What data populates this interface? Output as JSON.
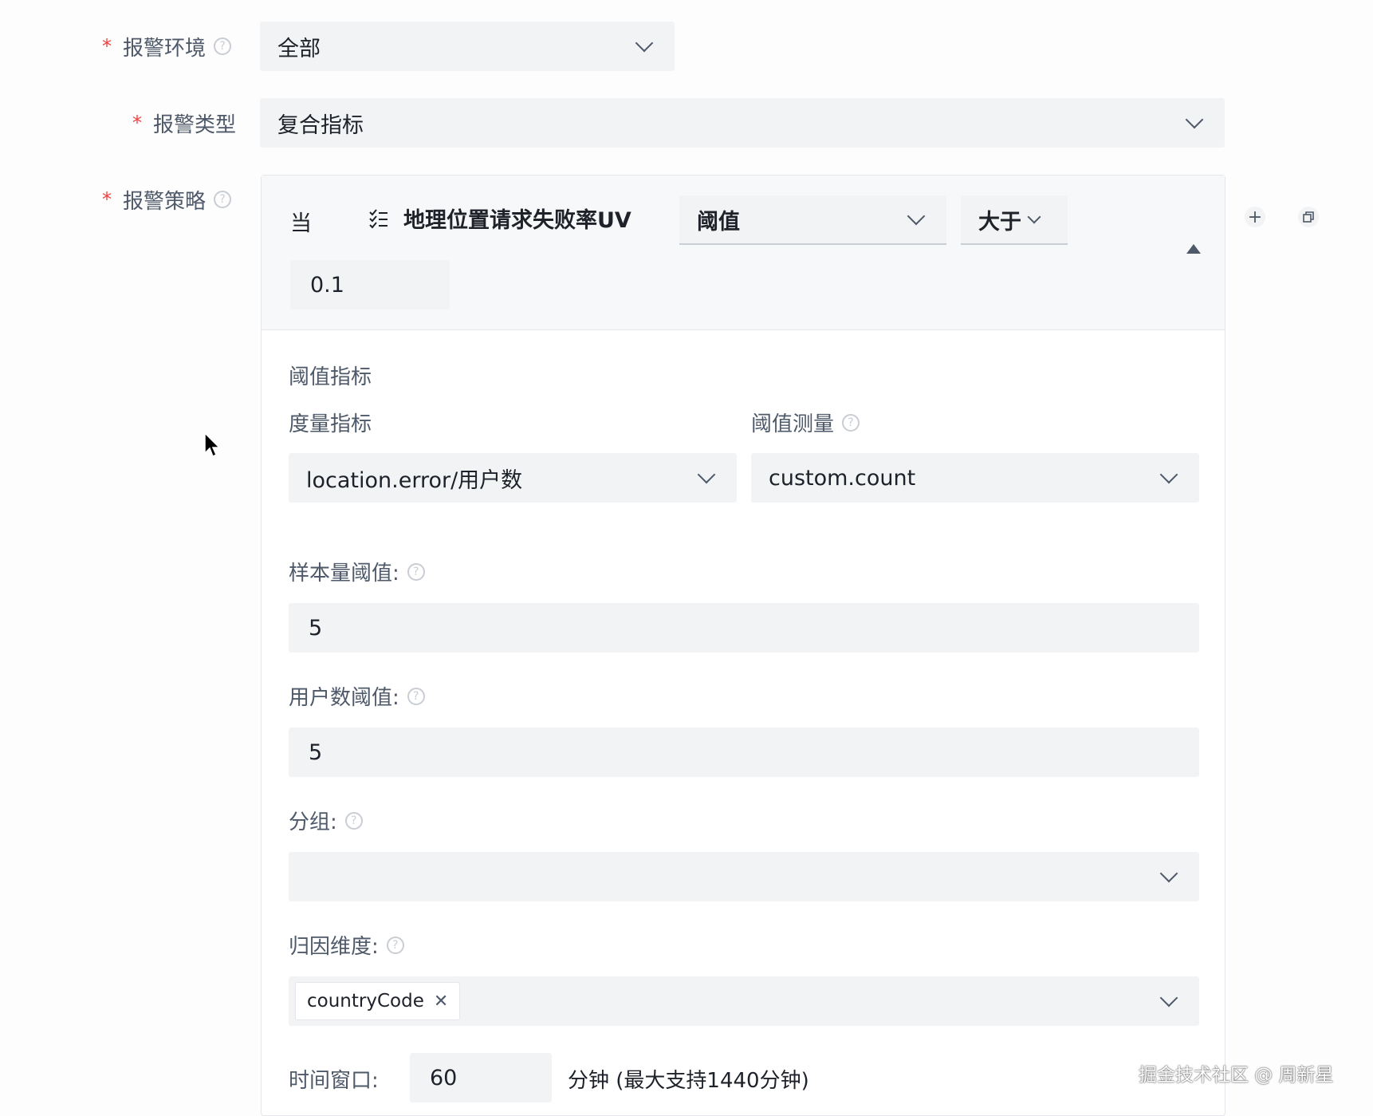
{
  "form": {
    "env": {
      "label": "报警环境",
      "value": "全部"
    },
    "type": {
      "label": "报警类型",
      "value": "复合指标"
    },
    "strategy": {
      "label": "报警策略"
    }
  },
  "condition": {
    "when_label": "当",
    "metric_name": "地理位置请求失败率UV",
    "mode": "阈值",
    "operator": "大于",
    "threshold": "0.1"
  },
  "detail": {
    "section_title": "阈值指标",
    "measure_label": "度量指标",
    "measure_value": "location.error/用户数",
    "threshold_measure_label": "阈值测量",
    "threshold_measure_value": "custom.count",
    "sample_label": "样本量阈值:",
    "sample_value": "5",
    "user_label": "用户数阈值:",
    "user_value": "5",
    "group_label": "分组:",
    "group_value": "",
    "attribution_label": "归因维度:",
    "attribution_tags": [
      "countryCode"
    ],
    "window_label": "时间窗口:",
    "window_value": "60",
    "window_suffix": "分钟 (最大支持1440分钟)"
  },
  "watermark": "掘金技术社区 @ 周新星",
  "icons": [
    "help-icon",
    "chevron-down-icon",
    "list-icon",
    "plus-icon",
    "copy-icon",
    "collapse-icon",
    "close-icon",
    "mouse-cursor-icon"
  ],
  "colors": {
    "required": "#f53f3f",
    "input_bg": "#f2f3f5",
    "label": "#4e5969",
    "border": "#e5e6eb"
  }
}
